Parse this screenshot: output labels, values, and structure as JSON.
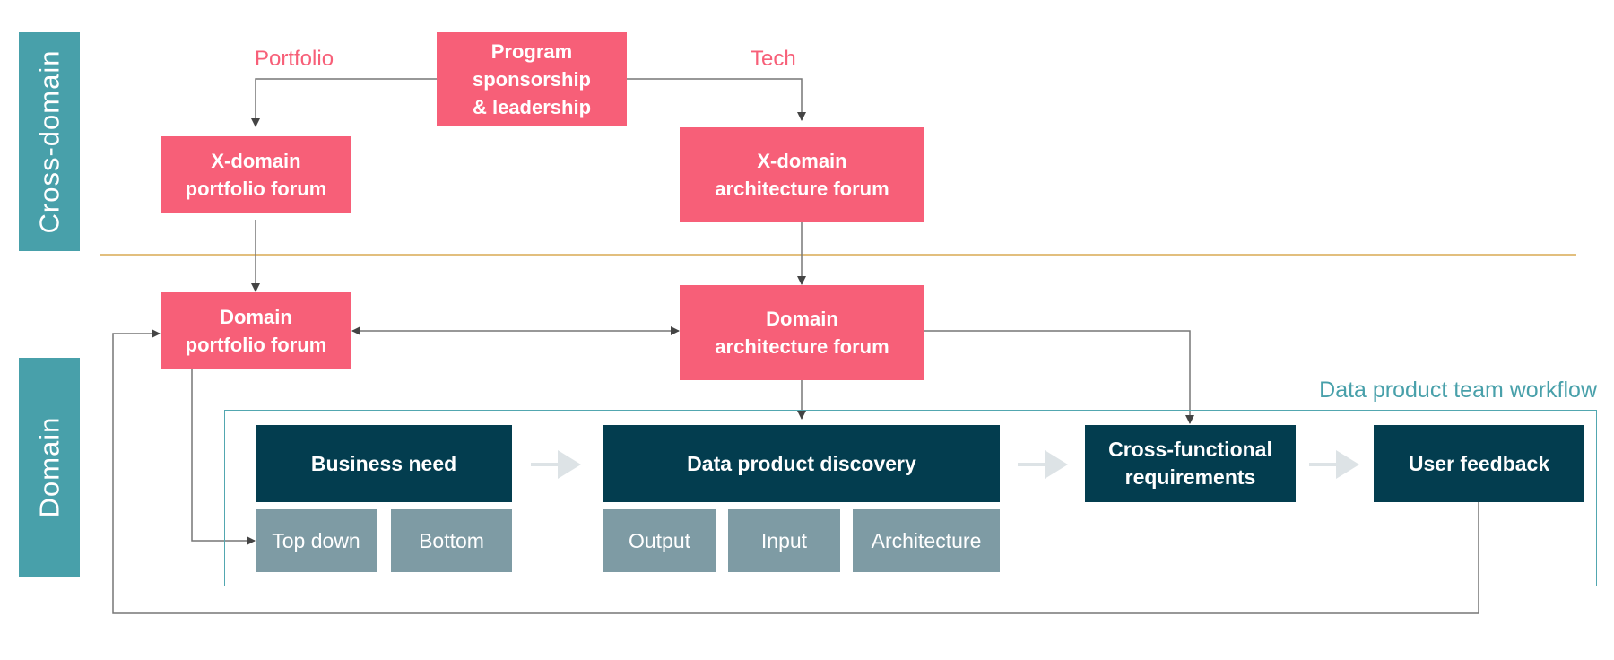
{
  "lanes": {
    "cross_domain": "Cross-domain",
    "domain": "Domain"
  },
  "labels": {
    "portfolio": "Portfolio",
    "tech": "Tech",
    "workflow_title": "Data product team workflow"
  },
  "nodes": {
    "program": "Program sponsorship & leadership",
    "program_lines": [
      "Program",
      "sponsorship",
      "& leadership"
    ],
    "xdomain_portfolio_lines": [
      "X-domain",
      "portfolio forum"
    ],
    "xdomain_architecture_lines": [
      "X-domain",
      "architecture forum"
    ],
    "domain_portfolio_lines": [
      "Domain",
      "portfolio forum"
    ],
    "domain_architecture_lines": [
      "Domain",
      "architecture forum"
    ]
  },
  "workflow": {
    "steps": [
      {
        "label_lines": [
          "Business need"
        ],
        "sub": [
          "Top down",
          "Bottom"
        ]
      },
      {
        "label_lines": [
          "Data product discovery"
        ],
        "sub": [
          "Output",
          "Input",
          "Architecture"
        ]
      },
      {
        "label_lines": [
          "Cross-functional",
          "requirements"
        ],
        "sub": []
      },
      {
        "label_lines": [
          "User feedback"
        ],
        "sub": []
      }
    ]
  },
  "colors": {
    "lane": "#48a0aa",
    "forum": "#f75f78",
    "step": "#033d4f",
    "substep": "#7e9ba4",
    "divider": "#e2bf7e",
    "connector": "#555555",
    "flow_arrow": "#dde3e6"
  }
}
